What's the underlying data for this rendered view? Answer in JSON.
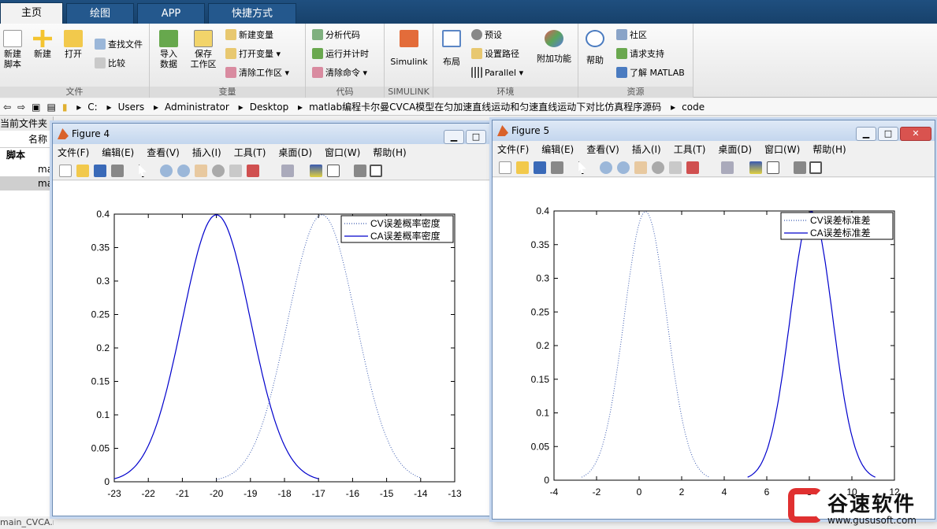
{
  "tabs": [
    {
      "label": "主页",
      "active": true
    },
    {
      "label": "绘图",
      "active": false
    },
    {
      "label": "APP",
      "active": false
    },
    {
      "label": "快捷方式",
      "active": false
    }
  ],
  "ribbon": {
    "file_group": {
      "label": "文件",
      "new_script": "新建\n脚本",
      "new": "新建",
      "open": "打开",
      "find_files": "查找文件",
      "compare": "比较"
    },
    "variable_group": {
      "label": "变量",
      "import": "导入\n数据",
      "save_ws": "保存\n工作区",
      "new_var": "新建变量",
      "open_var": "打开变量",
      "clear_ws": "清除工作区"
    },
    "code_group": {
      "label": "代码",
      "analyze": "分析代码",
      "run_time": "运行并计时",
      "clear_cmd": "清除命令"
    },
    "simulink_group": {
      "label": "SIMULINK",
      "simulink": "Simulink"
    },
    "env_group": {
      "label": "环境",
      "layout": "布局",
      "prefs": "预设",
      "set_path": "设置路径",
      "parallel": "Parallel",
      "addons": "附加功能"
    },
    "resources_group": {
      "label": "资源",
      "help": "帮助",
      "community": "社区",
      "support": "请求支持",
      "learn": "了解 MATLAB"
    }
  },
  "address": [
    "C:",
    "Users",
    "Administrator",
    "Desktop",
    "matlab编程卡尔曼CVCA模型在匀加速直线运动和匀速直线运动下对比仿真程序源码",
    "code"
  ],
  "left_panel": {
    "title": "当前文件夹",
    "col_name": "名称",
    "section": "脚本",
    "items": [
      "ma",
      "ma"
    ],
    "footer": "main_CVCA.m"
  },
  "figure4": {
    "title": "Figure 4",
    "menu": [
      "文件(F)",
      "编辑(E)",
      "查看(V)",
      "插入(I)",
      "工具(T)",
      "桌面(D)",
      "窗口(W)",
      "帮助(H)"
    ],
    "legend": [
      "CV误差概率密度",
      "CA误差概率密度"
    ]
  },
  "figure5": {
    "title": "Figure 5",
    "menu": [
      "文件(F)",
      "编辑(E)",
      "查看(V)",
      "插入(I)",
      "工具(T)",
      "桌面(D)",
      "窗口(W)",
      "帮助(H)"
    ],
    "legend": [
      "CV误差标准差",
      "CA误差标准差"
    ]
  },
  "watermark": {
    "text": "谷速软件",
    "url": "www.gususoft.com"
  },
  "chart_data": [
    {
      "type": "line",
      "xlim": [
        -23,
        -13
      ],
      "ylim": [
        0,
        0.4
      ],
      "xticks": [
        -23,
        -22,
        -21,
        -20,
        -19,
        -18,
        -17,
        -16,
        -15,
        -14,
        -13
      ],
      "yticks": [
        0,
        0.05,
        0.1,
        0.15,
        0.2,
        0.25,
        0.3,
        0.35,
        0.4
      ],
      "legend_position": "top-right",
      "series": [
        {
          "name": "CV误差概率密度",
          "style": "dotted",
          "color": "#3a5ab0",
          "mean": -16.9,
          "sigma": 1.0,
          "x_range": [
            -20.0,
            -14.0
          ]
        },
        {
          "name": "CA误差概率密度",
          "style": "solid",
          "color": "#0000cc",
          "mean": -20.0,
          "sigma": 1.0,
          "x_range": [
            -23.0,
            -17.0
          ]
        }
      ]
    },
    {
      "type": "line",
      "xlim": [
        -4,
        12
      ],
      "ylim": [
        0,
        0.4
      ],
      "xticks": [
        -4,
        -2,
        0,
        2,
        4,
        6,
        8,
        10,
        12
      ],
      "yticks": [
        0,
        0.05,
        0.1,
        0.15,
        0.2,
        0.25,
        0.3,
        0.35,
        0.4
      ],
      "legend_position": "top-right",
      "series": [
        {
          "name": "CV误差标准差",
          "style": "dotted",
          "color": "#3a5ab0",
          "mean": 0.3,
          "sigma": 1.0,
          "x_range": [
            -2.7,
            3.3
          ]
        },
        {
          "name": "CA误差标准差",
          "style": "solid",
          "color": "#0000cc",
          "mean": 8.1,
          "sigma": 1.0,
          "x_range": [
            5.1,
            11.1
          ]
        }
      ]
    }
  ]
}
